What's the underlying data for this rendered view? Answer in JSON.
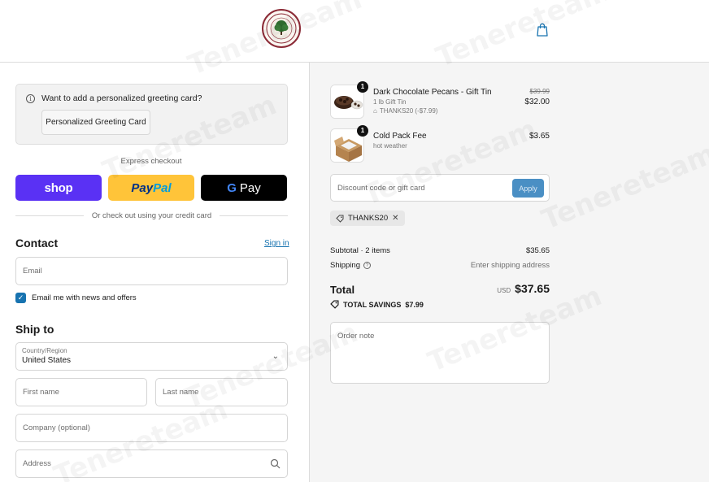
{
  "header": {
    "logo_icon": "store-logo-tree-seal-icon",
    "cart_icon": "shopping-bag-icon"
  },
  "greeting": {
    "question": "Want to add a personalized greeting card?",
    "button_label": "Personalized Greeting Card"
  },
  "express": {
    "label": "Express checkout",
    "shop_label": "shop",
    "paypal_label_1": "Pay",
    "paypal_label_2": "Pal",
    "gpay_g": "G",
    "gpay_label": "Pay",
    "divider_text": "Or check out using your credit card"
  },
  "contact": {
    "title": "Contact",
    "signin_label": "Sign in",
    "email_placeholder": "Email",
    "newsletter_label": "Email me with news and offers",
    "newsletter_checked": true
  },
  "ship_to": {
    "title": "Ship to",
    "country_label": "Country/Region",
    "country_value": "United States",
    "first_name_placeholder": "First name",
    "last_name_placeholder": "Last name",
    "company_placeholder": "Company (optional)",
    "address_placeholder": "Address"
  },
  "cart": {
    "items": [
      {
        "quantity": "1",
        "name": "Dark Chocolate Pecans - Gift Tin",
        "variant": "1 lb Gift Tin",
        "discount": "THANKS20 (-$7.99)",
        "original_price": "$39.99",
        "price": "$32.00"
      },
      {
        "quantity": "1",
        "name": "Cold Pack Fee",
        "variant": "hot weather",
        "price": "$3.65"
      }
    ],
    "discount_placeholder": "Discount code or gift card",
    "apply_label": "Apply",
    "applied_code": "THANKS20",
    "subtotal_label": "Subtotal · 2 items",
    "subtotal_value": "$35.65",
    "shipping_label": "Shipping",
    "shipping_value": "Enter shipping address",
    "total_label": "Total",
    "currency": "USD",
    "total_value": "$37.65",
    "savings_label": "TOTAL SAVINGS",
    "savings_value": "$7.99",
    "order_note_placeholder": "Order note"
  },
  "watermark": "Tenereteam",
  "colors": {
    "accent": "#1773b0",
    "shop_pay": "#5a31f4",
    "paypal": "#ffc439",
    "gpay": "#000000"
  }
}
